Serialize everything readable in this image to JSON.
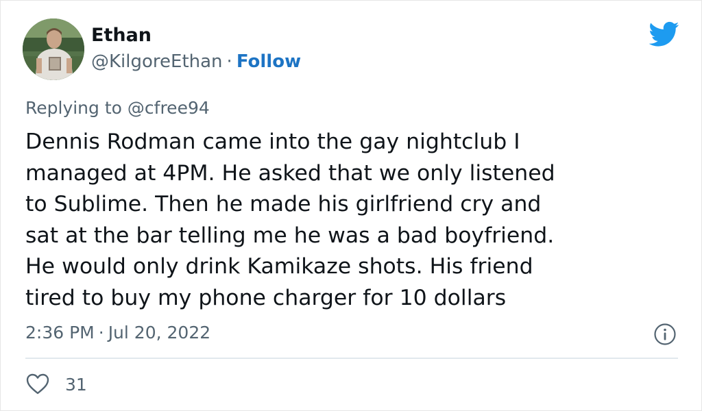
{
  "tweet": {
    "author_name": "Ethan",
    "author_handle": "@KilgoreEthan",
    "separator": "·",
    "follow_label": "Follow",
    "replying_prefix": "Replying to",
    "replying_to": "@cfree94",
    "text_lines": [
      "Dennis Rodman came into the gay nightclub I",
      "managed at 4PM. He asked that we only listened",
      "to Sublime. Then he made his girlfriend cry and",
      "sat at the bar telling me he was a bad boyfriend.",
      "He would only drink Kamikaze shots. His friend",
      "tired to buy my phone charger for 10 dollars"
    ],
    "time": "2:36 PM",
    "date": "Jul 20, 2022",
    "like_count": "31"
  },
  "icons": {
    "brand": "twitter-bird-icon",
    "info": "info-icon",
    "like": "heart-icon"
  },
  "colors": {
    "brand_blue": "#1d9bf0",
    "follow_blue": "#1d74c4",
    "muted_text": "#536471",
    "main_text": "#0f1419",
    "divider": "#e1e8ed"
  }
}
